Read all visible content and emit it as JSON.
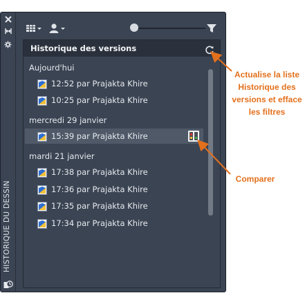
{
  "sidebar": {
    "vertical_title": "HISTORIQUE DU DESSIN",
    "close_glyph": "✕",
    "pin_glyph": "⧗",
    "settings_glyph": "✱"
  },
  "panel": {
    "title": "Historique des versions",
    "groups": [
      {
        "label": "Aujourd'hui",
        "items": [
          {
            "label": "12:52 par Prajakta Khire"
          },
          {
            "label": "10:25 par Prajakta Khire"
          }
        ]
      },
      {
        "label": "mercredi 29 janvier",
        "items": [
          {
            "label": "15:39 par Prajakta Khire",
            "selected": true
          }
        ]
      },
      {
        "label": "mardi 21 janvier",
        "items": [
          {
            "label": "17:38 par Prajakta Khire"
          },
          {
            "label": "17:36 par Prajakta Khire"
          },
          {
            "label": "17:35 par Prajakta Khire"
          },
          {
            "label": "17:34 par Prajakta Khire"
          }
        ]
      }
    ]
  },
  "slider": {
    "level": 0.0
  },
  "callouts": {
    "refresh": "Actualise la liste Historique des versions et efface les filtres",
    "compare": "Comparer"
  },
  "colors": {
    "accent": "#e3701c",
    "panel_bg": "#3b4453",
    "header_bg": "#2b313c",
    "selected_row": "#4f5968"
  },
  "icons": [
    "close-icon",
    "pin-icon",
    "settings-icon",
    "history-icon",
    "grid-view-icon",
    "user-filter-icon",
    "filter-icon",
    "refresh-icon",
    "drawing-file-icon",
    "compare-icon"
  ]
}
